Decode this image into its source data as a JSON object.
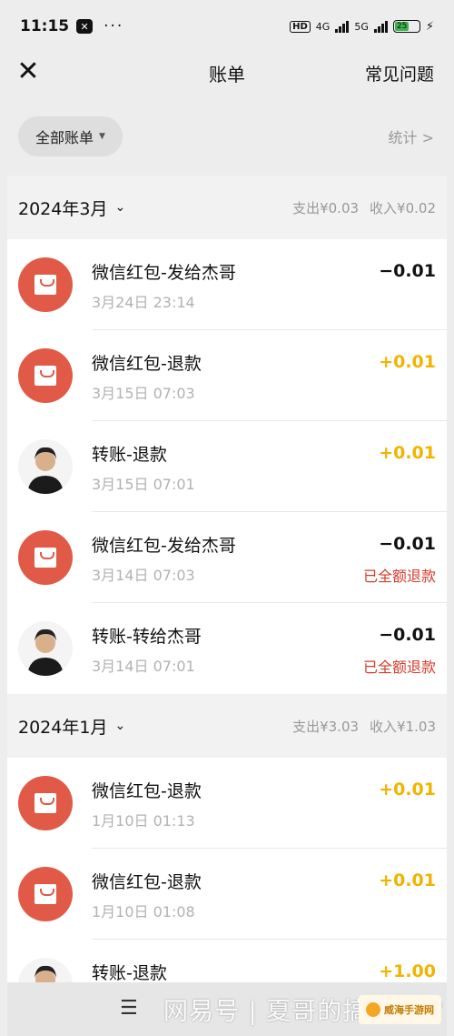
{
  "status_bar": {
    "time": "11:15",
    "net1": "4G",
    "net2": "5G",
    "hd": "HD",
    "battery": "25"
  },
  "nav": {
    "close_icon": "close-icon",
    "title": "账单",
    "faq_label": "常见问题"
  },
  "filter": {
    "label": "全部账单",
    "stats_label": "统计 >"
  },
  "groups": [
    {
      "month": "2024年3月",
      "expense": "支出¥0.03",
      "income": "收入¥0.02",
      "items": [
        {
          "icon": "red-packet-icon",
          "name": "微信红包-发给杰哥",
          "date": "3月24日 23:14",
          "amount": "−0.01",
          "status": ""
        },
        {
          "icon": "red-packet-icon",
          "name": "微信红包-退款",
          "date": "3月15日 07:03",
          "amount": "+0.01",
          "status": ""
        },
        {
          "icon": "user-avatar",
          "name": "转账-退款",
          "date": "3月15日 07:01",
          "amount": "+0.01",
          "status": ""
        },
        {
          "icon": "red-packet-icon",
          "name": "微信红包-发给杰哥",
          "date": "3月14日 07:03",
          "amount": "−0.01",
          "status": "已全额退款"
        },
        {
          "icon": "user-avatar",
          "name": "转账-转给杰哥",
          "date": "3月14日 07:01",
          "amount": "−0.01",
          "status": "已全额退款"
        }
      ]
    },
    {
      "month": "2024年1月",
      "expense": "支出¥3.03",
      "income": "收入¥1.03",
      "items": [
        {
          "icon": "red-packet-icon",
          "name": "微信红包-退款",
          "date": "1月10日 01:13",
          "amount": "+0.01",
          "status": ""
        },
        {
          "icon": "red-packet-icon",
          "name": "微信红包-退款",
          "date": "1月10日 01:08",
          "amount": "+0.01",
          "status": ""
        },
        {
          "icon": "user-avatar",
          "name": "转账-退款",
          "date": "",
          "amount": "+1.00",
          "status": ""
        }
      ]
    }
  ],
  "bottom": {
    "menu_icon": "menu-icon",
    "watermark": "网易号 | 夏哥的搞笑日常",
    "badge": "威海手游网"
  },
  "colors": {
    "red_packet": "#e05a47",
    "income": "#f0b400",
    "refund": "#d33c2d",
    "muted": "#b2b2b2"
  }
}
